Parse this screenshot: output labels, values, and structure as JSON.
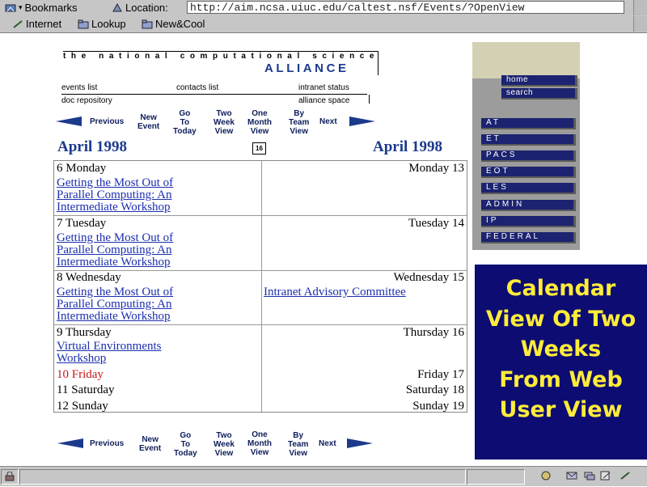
{
  "toolbar": {
    "bookmarks_label": "Bookmarks",
    "location_label": "Location:",
    "url": "http://aim.ncsa.uiuc.edu/caltest.nsf/Events/?OpenView",
    "personal": [
      "Internet",
      "Lookup",
      "New&Cool"
    ]
  },
  "header": {
    "org_line": "the national computational science",
    "org_name": "ALLIANCE",
    "links": {
      "events_list": "events list",
      "contacts_list": "contacts list",
      "intranet_status": "intranet status",
      "doc_repository": "doc repository",
      "alliance_space": "alliance space"
    }
  },
  "nav": {
    "previous": "Previous",
    "new_event": [
      "New",
      "Event"
    ],
    "go_today": [
      "Go",
      "To",
      "Today"
    ],
    "two_week": [
      "Two",
      "Week",
      "View"
    ],
    "one_month": [
      "One",
      "Month",
      "View"
    ],
    "by_team": [
      "By",
      "Team",
      "View"
    ],
    "next": "Next"
  },
  "calendar": {
    "month_left": "April 1998",
    "month_right": "April 1998",
    "date_icon": "16",
    "days": {
      "d6": "6 Monday",
      "d7": "7 Tuesday",
      "d8": "8 Wednesday",
      "d9": "9 Thursday",
      "d10": "10 Friday",
      "d11": "11 Saturday",
      "d12": "12 Sunday",
      "d13": "Monday 13",
      "d14": "Tuesday 14",
      "d15": "Wednesday 15",
      "d16": "Thursday 16",
      "d17": "Friday 17",
      "d18": "Saturday 18",
      "d19": "Sunday 19"
    },
    "events": {
      "parallel": [
        "Getting the Most Out of",
        "Parallel Computing: An",
        "Intermediate Workshop"
      ],
      "virtual": [
        "Virtual Environments",
        "Workshop"
      ],
      "intranet": "Intranet Advisory Committee"
    }
  },
  "sidebar": {
    "items": [
      "home",
      "search",
      "AT",
      "ET",
      "PACS",
      "EOT",
      "LES",
      "ADMIN",
      "IP",
      "FEDERAL"
    ]
  },
  "caption": {
    "lines": [
      "Calendar",
      "View Of Two",
      "Weeks",
      "From Web",
      "User View"
    ],
    "color": "#ffec3a",
    "background": "#0c0c72"
  },
  "colors": {
    "accent_blue": "#1c3a8c",
    "link_blue": "#1c2fae",
    "weekend_red": "#c41818"
  }
}
